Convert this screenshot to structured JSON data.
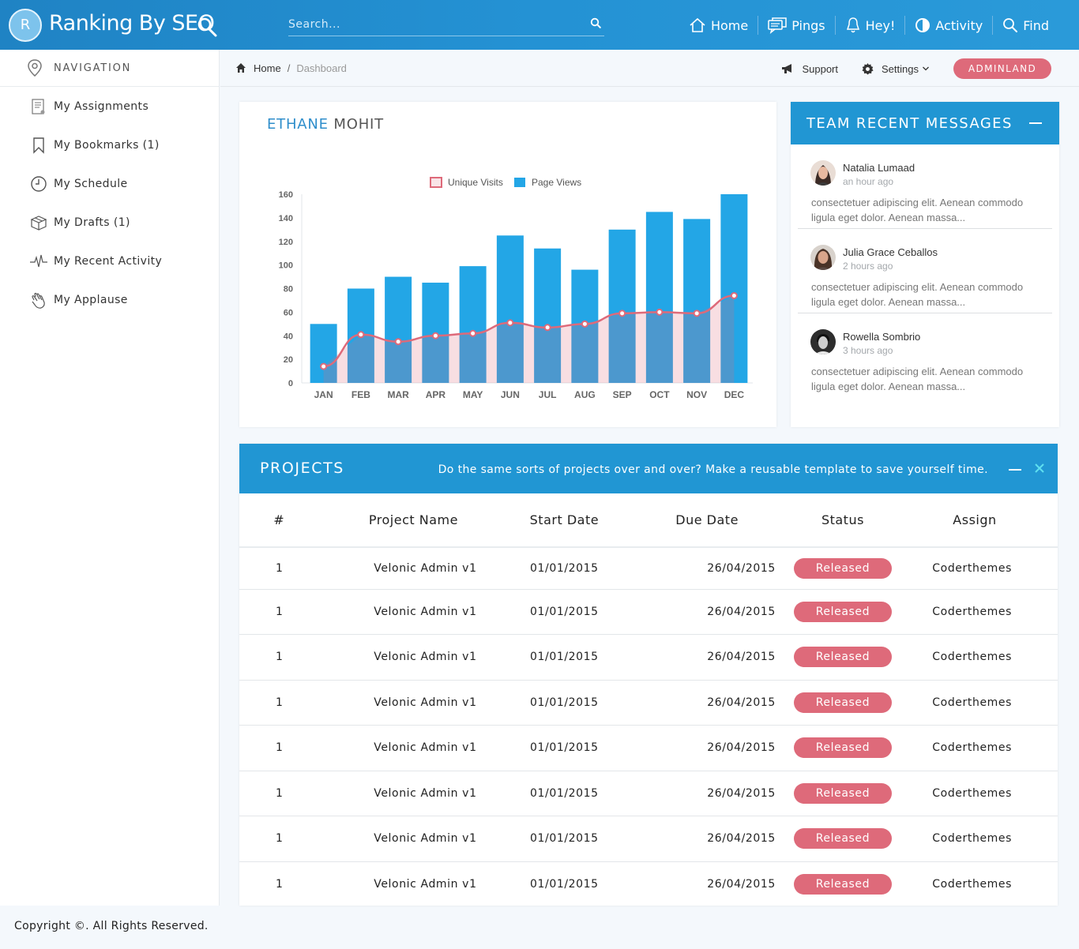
{
  "brand": {
    "initial": "R",
    "name": "Ranking By SEO"
  },
  "search": {
    "placeholder": "Search..."
  },
  "topnav": [
    {
      "label": "Home",
      "icon": "home-icon"
    },
    {
      "label": "Pings",
      "icon": "chat-bubbles-icon"
    },
    {
      "label": "Hey!",
      "icon": "bell-icon"
    },
    {
      "label": "Activity",
      "icon": "pie-icon"
    },
    {
      "label": "Find",
      "icon": "search-icon"
    }
  ],
  "sidebar": {
    "heading": "NAVIGATION",
    "items": [
      {
        "label": "My Assignments",
        "icon": "assignment-icon"
      },
      {
        "label": "My Bookmarks (1)",
        "icon": "bookmark-icon"
      },
      {
        "label": "My Schedule",
        "icon": "clock-icon"
      },
      {
        "label": "My Drafts (1)",
        "icon": "box-icon"
      },
      {
        "label": "My Recent Activity",
        "icon": "pulse-icon"
      },
      {
        "label": "My Applause",
        "icon": "clap-icon"
      }
    ]
  },
  "breadcrumb": {
    "home": "Home",
    "sep": "/",
    "current": "Dashboard"
  },
  "toolbar": {
    "support": "Support",
    "settings": "Settings",
    "admin": "ADMINLAND"
  },
  "chart_card": {
    "title_first": "ETHANE",
    "title_last": "MOHIT"
  },
  "chart_data": {
    "type": "bar",
    "categories": [
      "JAN",
      "FEB",
      "MAR",
      "APR",
      "MAY",
      "JUN",
      "JUL",
      "AUG",
      "SEP",
      "OCT",
      "NOV",
      "DEC"
    ],
    "series": [
      {
        "name": "Unique Visits",
        "type": "area-line",
        "color": "#de6a7a",
        "values": [
          14,
          41,
          35,
          40,
          42,
          51,
          47,
          50,
          59,
          60,
          59,
          74
        ]
      },
      {
        "name": "Page Views",
        "type": "bar",
        "color": "#23a6e6",
        "values": [
          50,
          80,
          90,
          85,
          99,
          125,
          114,
          96,
          130,
          145,
          139,
          160
        ]
      }
    ],
    "ylim": [
      0,
      160
    ],
    "yticks": [
      0,
      20,
      40,
      60,
      80,
      100,
      120,
      140,
      160
    ],
    "legend": "top-center",
    "grid": false
  },
  "messages": {
    "title": "TEAM RECENT MESSAGES",
    "items": [
      {
        "name": "Natalia Lumaad",
        "time": "an hour ago",
        "text": "consectetuer adipiscing elit. Aenean commodo ligula eget dolor. Aenean massa..."
      },
      {
        "name": "Julia Grace Ceballos",
        "time": "2 hours ago",
        "text": "consectetuer adipiscing elit. Aenean commodo ligula eget dolor. Aenean massa..."
      },
      {
        "name": "Rowella Sombrio",
        "time": "3 hours ago",
        "text": "consectetuer adipiscing elit. Aenean commodo ligula eget dolor. Aenean massa..."
      }
    ]
  },
  "projects": {
    "title": "PROJECTS",
    "tip": "Do the same sorts of projects over and over? Make a reusable template to save yourself time.",
    "columns": [
      "#",
      "Project Name",
      "Start Date",
      "Due Date",
      "Status",
      "Assign"
    ],
    "rows": [
      {
        "num": "1",
        "name": "Velonic Admin v1",
        "start": "01/01/2015",
        "due": "26/04/2015",
        "status": "Released",
        "assign": "Coderthemes"
      },
      {
        "num": "1",
        "name": "Velonic Admin v1",
        "start": "01/01/2015",
        "due": "26/04/2015",
        "status": "Released",
        "assign": "Coderthemes"
      },
      {
        "num": "1",
        "name": "Velonic Admin v1",
        "start": "01/01/2015",
        "due": "26/04/2015",
        "status": "Released",
        "assign": "Coderthemes"
      },
      {
        "num": "1",
        "name": "Velonic Admin v1",
        "start": "01/01/2015",
        "due": "26/04/2015",
        "status": "Released",
        "assign": "Coderthemes"
      },
      {
        "num": "1",
        "name": "Velonic Admin v1",
        "start": "01/01/2015",
        "due": "26/04/2015",
        "status": "Released",
        "assign": "Coderthemes"
      },
      {
        "num": "1",
        "name": "Velonic Admin v1",
        "start": "01/01/2015",
        "due": "26/04/2015",
        "status": "Released",
        "assign": "Coderthemes"
      },
      {
        "num": "1",
        "name": "Velonic Admin v1",
        "start": "01/01/2015",
        "due": "26/04/2015",
        "status": "Released",
        "assign": "Coderthemes"
      },
      {
        "num": "1",
        "name": "Velonic Admin v1",
        "start": "01/01/2015",
        "due": "26/04/2015",
        "status": "Released",
        "assign": "Coderthemes"
      }
    ]
  },
  "footer": {
    "text": "Copyright ©. All Rights Reserved."
  },
  "colors": {
    "primary": "#2196d3",
    "accent": "#de6a7a",
    "bar": "#23a6e6"
  }
}
